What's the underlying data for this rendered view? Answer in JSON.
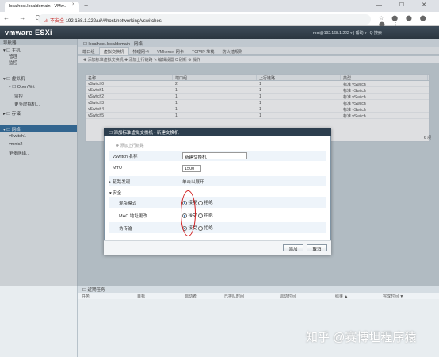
{
  "browser": {
    "tab_title": "localhost.localdomain - VMw...",
    "tab_close": "×",
    "new_tab": "+",
    "window_controls": "—  ☐  ✕",
    "nav": "←  →  C",
    "security_label": "⚠ 不安全",
    "url": "192.168.1.222/ui/#/host/networking/vswitches",
    "extensions": "☆ ⬤ ⬤ ⬤ ⬤ ⋮"
  },
  "vmware": {
    "logo": "vmware ESXi",
    "user_info": "root@192.168.1.222 ▾  |  帮助 ▾  |  Q 搜索"
  },
  "leftnav": {
    "header": "导航器",
    "items": [
      {
        "label": "▾ ☐ 主机",
        "indent": 0
      },
      {
        "label": "管理",
        "indent": 1
      },
      {
        "label": "监控",
        "indent": 1
      },
      {
        "label": "▾ ☐ 虚拟机",
        "indent": 0
      },
      {
        "label": "▾ ☐ OpenWrt",
        "indent": 1
      },
      {
        "label": "监控",
        "indent": 2
      },
      {
        "label": "更多虚拟机...",
        "indent": 2
      },
      {
        "label": "▸ ☐ 存储",
        "indent": 0
      },
      {
        "label": "▾ ☐ 网络",
        "indent": 0,
        "selected": true
      },
      {
        "label": "vSwitch1",
        "indent": 1
      },
      {
        "label": "vmnic2",
        "indent": 1
      },
      {
        "label": "更多网络...",
        "indent": 1
      }
    ]
  },
  "main": {
    "title": "☐ localhost.localdomain - 网络",
    "tabs": [
      "端口组",
      "虚拟交换机",
      "物理网卡",
      "VMkernel 网卡",
      "TCP/IP 堆栈",
      "防火墙规则"
    ],
    "active_tab": 1,
    "toolbar": "✚ 添加标准虚拟交换机   ✚ 添加上行链路   ✎ 编辑设置   C 刷新   ⚙ 操作",
    "columns": [
      "名称",
      "端口组",
      "上行链路",
      "类型"
    ],
    "rows": [
      {
        "name": "vSwitch0",
        "port_groups": "2",
        "uplinks": "1",
        "type": "标准 vSwitch"
      },
      {
        "name": "vSwitch1",
        "port_groups": "1",
        "uplinks": "1",
        "type": "标准 vSwitch"
      },
      {
        "name": "vSwitch2",
        "port_groups": "1",
        "uplinks": "1",
        "type": "标准 vSwitch"
      },
      {
        "name": "vSwitch3",
        "port_groups": "1",
        "uplinks": "1",
        "type": "标准 vSwitch"
      },
      {
        "name": "vSwitch4",
        "port_groups": "1",
        "uplinks": "1",
        "type": "标准 vSwitch"
      },
      {
        "name": "vSwitch5",
        "port_groups": "1",
        "uplinks": "1",
        "type": "标准 vSwitch"
      }
    ],
    "count": "6 项"
  },
  "recent": {
    "title": "☐ 近期任务",
    "columns": [
      "任务",
      "目标",
      "启动者",
      "已排队时间",
      "启动时间",
      "结果 ▲",
      "完成时间 ▼"
    ]
  },
  "dialog": {
    "title": "☐ 添加标准虚拟交换机 - 新建交换机",
    "add_uplink": "✚ 添加上行链路",
    "vswitch_name_label": "vSwitch 名称",
    "vswitch_name_value": "新建交换机",
    "mtu_label": "MTU",
    "mtu_value": "1500",
    "link_discovery_label": "▸ 链路发现",
    "link_discovery_value": "单击以展开",
    "security_label": "▾ 安全",
    "security_rows": [
      {
        "label": "混杂模式",
        "accept": "接受",
        "reject": "拒绝",
        "selected": "accept"
      },
      {
        "label": "MAC 地址更改",
        "accept": "接受",
        "reject": "拒绝",
        "selected": "accept"
      },
      {
        "label": "伪传输",
        "accept": "接受",
        "reject": "拒绝",
        "selected": "accept"
      }
    ],
    "add_button": "添加",
    "cancel_button": "取消"
  },
  "watermark": "知乎 @赛博坦程序猿",
  "colors": {
    "vm_header": "#2b3640",
    "dialog_title": "#2c3e4e",
    "nav_selected": "#2e6b9b",
    "highlight_oval": "#d21e1e"
  }
}
